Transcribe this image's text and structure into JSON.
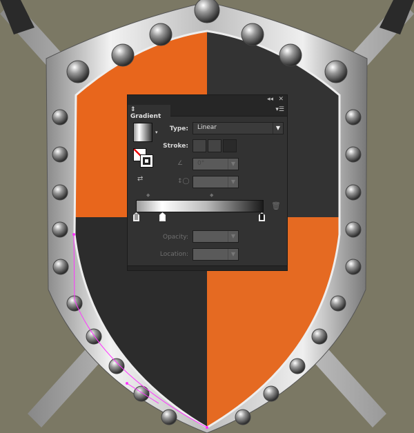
{
  "panel": {
    "title": "Gradient",
    "collapse_icon": "double-chevron-left-icon",
    "close_icon": "close-icon",
    "menu_icon": "panel-menu-icon",
    "type_label": "Type:",
    "type_value": "Linear",
    "stroke_label": "Stroke:",
    "angle_value": "0°",
    "aspect_value": "",
    "opacity_label": "Opacity:",
    "opacity_value": "",
    "location_label": "Location:",
    "location_value": "",
    "gradient_stops": [
      {
        "color": "#9a9a9a",
        "location": 0
      },
      {
        "color": "#ffffff",
        "location": 20
      },
      {
        "color": "#1a1a1a",
        "location": 100
      }
    ],
    "midpoints": [
      10,
      60
    ]
  },
  "colors": {
    "orange": "#e8661c",
    "dark_wood": "#2e2e2e",
    "metal": "#c9c9c9",
    "background": "#7b7864",
    "path": "#ff33ff"
  }
}
